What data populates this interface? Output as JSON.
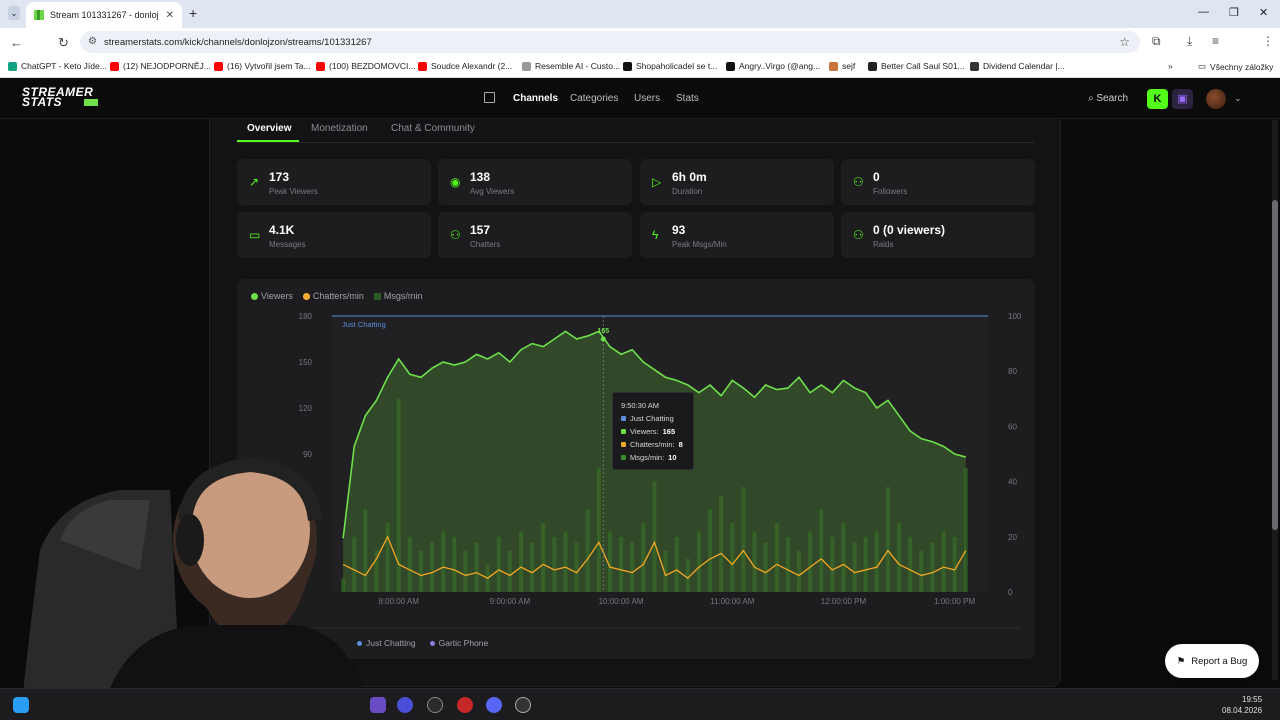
{
  "browser": {
    "tab_title": "Stream 101331267 - donlojzon",
    "url": "streamerstats.com/kick/channels/donlojzon/streams/101331267",
    "bookmarks": [
      {
        "label": "ChatGPT - Keto Jíde...",
        "color": "#10a37f"
      },
      {
        "label": "(12) NEJODPORNĚJ...",
        "color": "#ff0000"
      },
      {
        "label": "(16) Vytvořil jsem Ta...",
        "color": "#ff0000"
      },
      {
        "label": "(100) BEZDOMOVCI...",
        "color": "#ff0000"
      },
      {
        "label": "Soudce Alexandr (2...",
        "color": "#ff0000"
      },
      {
        "label": "Resemble AI - Custo...",
        "color": "#999999"
      },
      {
        "label": "Shopaholicadel se t...",
        "color": "#111111"
      },
      {
        "label": "Angry..Virgo (@ang...",
        "color": "#111111"
      },
      {
        "label": "sejf",
        "color": "#c9743a"
      },
      {
        "label": "Better Call Saul S01...",
        "color": "#222222"
      },
      {
        "label": "Dividend Calendar |...",
        "color": "#333333"
      }
    ],
    "all_bookmarks": "Všechny záložky",
    "profile_initial": "A"
  },
  "site": {
    "nav": [
      "Channels",
      "Categories",
      "Users",
      "Stats"
    ],
    "search_label": "Search",
    "logo_line1": "STREAMER",
    "logo_line2": "STATS"
  },
  "subtabs": [
    "Overview",
    "Monetization",
    "Chat & Community"
  ],
  "stats": [
    {
      "icon": "trending-up-icon",
      "glyph": "↗",
      "value": "173",
      "label": "Peak Viewers"
    },
    {
      "icon": "eye-icon",
      "glyph": "◉",
      "value": "138",
      "label": "Avg Viewers"
    },
    {
      "icon": "play-icon",
      "glyph": "▷",
      "value": "6h 0m",
      "label": "Duration"
    },
    {
      "icon": "user-plus-icon",
      "glyph": "⚇",
      "value": "0",
      "label": "Followers"
    },
    {
      "icon": "message-icon",
      "glyph": "▭",
      "value": "4.1K",
      "label": "Messages"
    },
    {
      "icon": "users-icon",
      "glyph": "⚇",
      "value": "157",
      "label": "Chatters"
    },
    {
      "icon": "zap-icon",
      "glyph": "ϟ",
      "value": "93",
      "label": "Peak Msgs/Min"
    },
    {
      "icon": "users-icon",
      "glyph": "⚇",
      "value": "0 (0 viewers)",
      "label": "Raids"
    }
  ],
  "chart_data": {
    "type": "line",
    "legend": [
      "Viewers",
      "Chatters/min",
      "Msgs/min"
    ],
    "colors": {
      "viewers": "#6fe04b",
      "chatters": "#f5a623",
      "msgs": "#2d5a24"
    },
    "x_ticks": [
      "8:00:00 AM",
      "9:00:00 AM",
      "10:00:00 AM",
      "11:00:00 AM",
      "12:00:00 PM",
      "1:00:00 PM"
    ],
    "y_left_ticks": [
      "180",
      "150",
      "120",
      "90"
    ],
    "y_right_ticks": [
      "100",
      "80",
      "60",
      "40",
      "20",
      "0"
    ],
    "y_left_range": [
      0,
      180
    ],
    "y_right_range": [
      0,
      100
    ],
    "category_band": "Just Chatting",
    "peak_label": "165",
    "x_hours": [
      7.5,
      7.6,
      7.7,
      7.8,
      7.9,
      8.0,
      8.1,
      8.2,
      8.3,
      8.4,
      8.5,
      8.6,
      8.7,
      8.8,
      8.9,
      9.0,
      9.1,
      9.2,
      9.3,
      9.4,
      9.5,
      9.6,
      9.7,
      9.8,
      9.9,
      10.0,
      10.1,
      10.2,
      10.3,
      10.4,
      10.5,
      10.6,
      10.7,
      10.8,
      10.9,
      11.0,
      11.1,
      11.2,
      11.3,
      11.4,
      11.5,
      11.6,
      11.7,
      11.8,
      11.9,
      12.0,
      12.1,
      12.2,
      12.3,
      12.4,
      12.5,
      12.6,
      12.7,
      12.8,
      12.9,
      13.0,
      13.1
    ],
    "viewers": [
      35,
      95,
      115,
      125,
      140,
      152,
      142,
      140,
      146,
      150,
      148,
      150,
      155,
      152,
      156,
      150,
      158,
      162,
      160,
      165,
      170,
      165,
      167,
      170,
      160,
      155,
      158,
      150,
      145,
      140,
      138,
      135,
      130,
      135,
      128,
      138,
      133,
      127,
      135,
      132,
      133,
      140,
      130,
      135,
      130,
      138,
      133,
      130,
      120,
      125,
      115,
      105,
      100,
      98,
      95,
      90,
      88
    ],
    "chatters_per_min": [
      10,
      8,
      6,
      12,
      20,
      10,
      8,
      6,
      7,
      9,
      8,
      6,
      7,
      5,
      8,
      6,
      9,
      7,
      10,
      8,
      9,
      7,
      12,
      18,
      9,
      8,
      7,
      10,
      18,
      6,
      8,
      5,
      9,
      12,
      14,
      10,
      15,
      9,
      7,
      10,
      8,
      6,
      9,
      12,
      8,
      10,
      7,
      8,
      9,
      15,
      10,
      8,
      6,
      7,
      9,
      8,
      15
    ],
    "msgs_per_min": [
      5,
      20,
      30,
      15,
      25,
      70,
      20,
      15,
      18,
      22,
      20,
      15,
      18,
      10,
      20,
      15,
      22,
      18,
      25,
      20,
      22,
      18,
      30,
      45,
      22,
      20,
      18,
      25,
      40,
      15,
      20,
      12,
      22,
      30,
      35,
      25,
      38,
      22,
      18,
      25,
      20,
      15,
      22,
      30,
      20,
      25,
      18,
      20,
      22,
      38,
      25,
      20,
      15,
      18,
      22,
      20,
      45
    ]
  },
  "tooltip": {
    "time": "9:50:30 AM",
    "category": "Just Chatting",
    "viewers_label": "Viewers:",
    "viewers": "165",
    "chatters_label": "Chatters/min:",
    "chatters": "8",
    "msgs_label": "Msgs/min:",
    "msgs": "10"
  },
  "category_legend": [
    {
      "label": "Just Chatting",
      "color": "#5b8dd9"
    },
    {
      "label": "Gartic Phone",
      "color": "#8b7fd9"
    }
  ],
  "report_bug": "Report a Bug",
  "taskbar": {
    "time": "19:55",
    "date": "08.04.2026"
  }
}
